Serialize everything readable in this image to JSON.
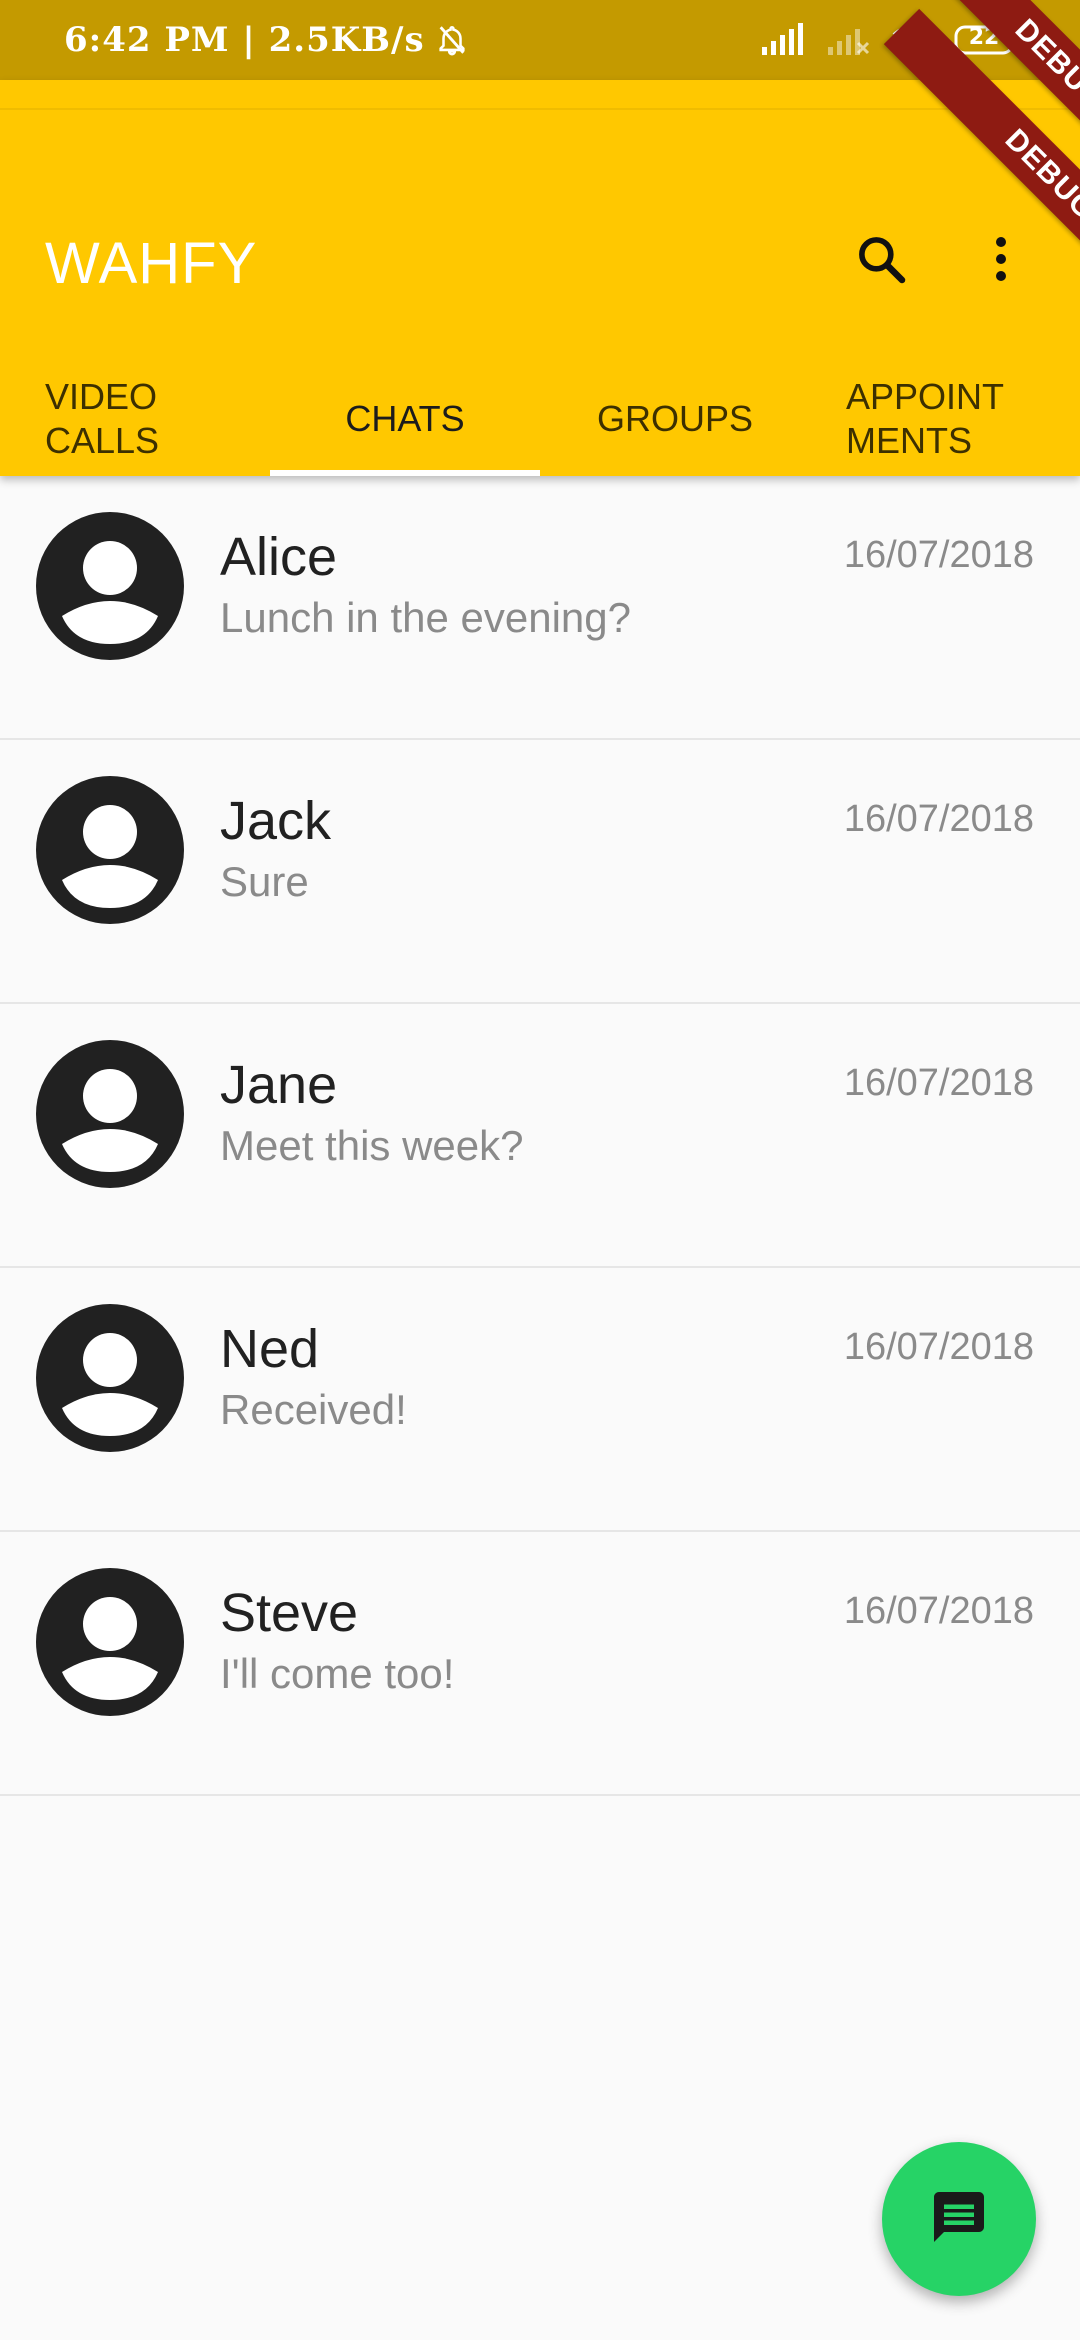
{
  "status_bar": {
    "time_speed": "6:42 PM | 2.5KB/s",
    "battery": "22"
  },
  "app_bar": {
    "title": "WAHFY",
    "tabs": [
      {
        "label": "VIDEO\nCALLS",
        "active": false
      },
      {
        "label": "CHATS",
        "active": true
      },
      {
        "label": "GROUPS",
        "active": false
      },
      {
        "label": "APPOINT\nMENTS",
        "active": false
      }
    ]
  },
  "chats": [
    {
      "name": "Alice",
      "message": "Lunch in the evening?",
      "date": "16/07/2018"
    },
    {
      "name": "Jack",
      "message": "Sure",
      "date": "16/07/2018"
    },
    {
      "name": "Jane",
      "message": "Meet this week?",
      "date": "16/07/2018"
    },
    {
      "name": "Ned",
      "message": "Received!",
      "date": "16/07/2018"
    },
    {
      "name": "Steve",
      "message": "I'll come too!",
      "date": "16/07/2018"
    }
  ],
  "debug_banner": {
    "label": "DEBUG"
  },
  "colors": {
    "app_bar": "#ffc800",
    "status_bar": "#c49a00",
    "fab": "#26d366",
    "debug": "#8e1b12"
  },
  "icons": {
    "search": "search-icon",
    "more": "more-vert-icon",
    "fab": "chat-icon",
    "avatar": "account-circle-icon"
  }
}
